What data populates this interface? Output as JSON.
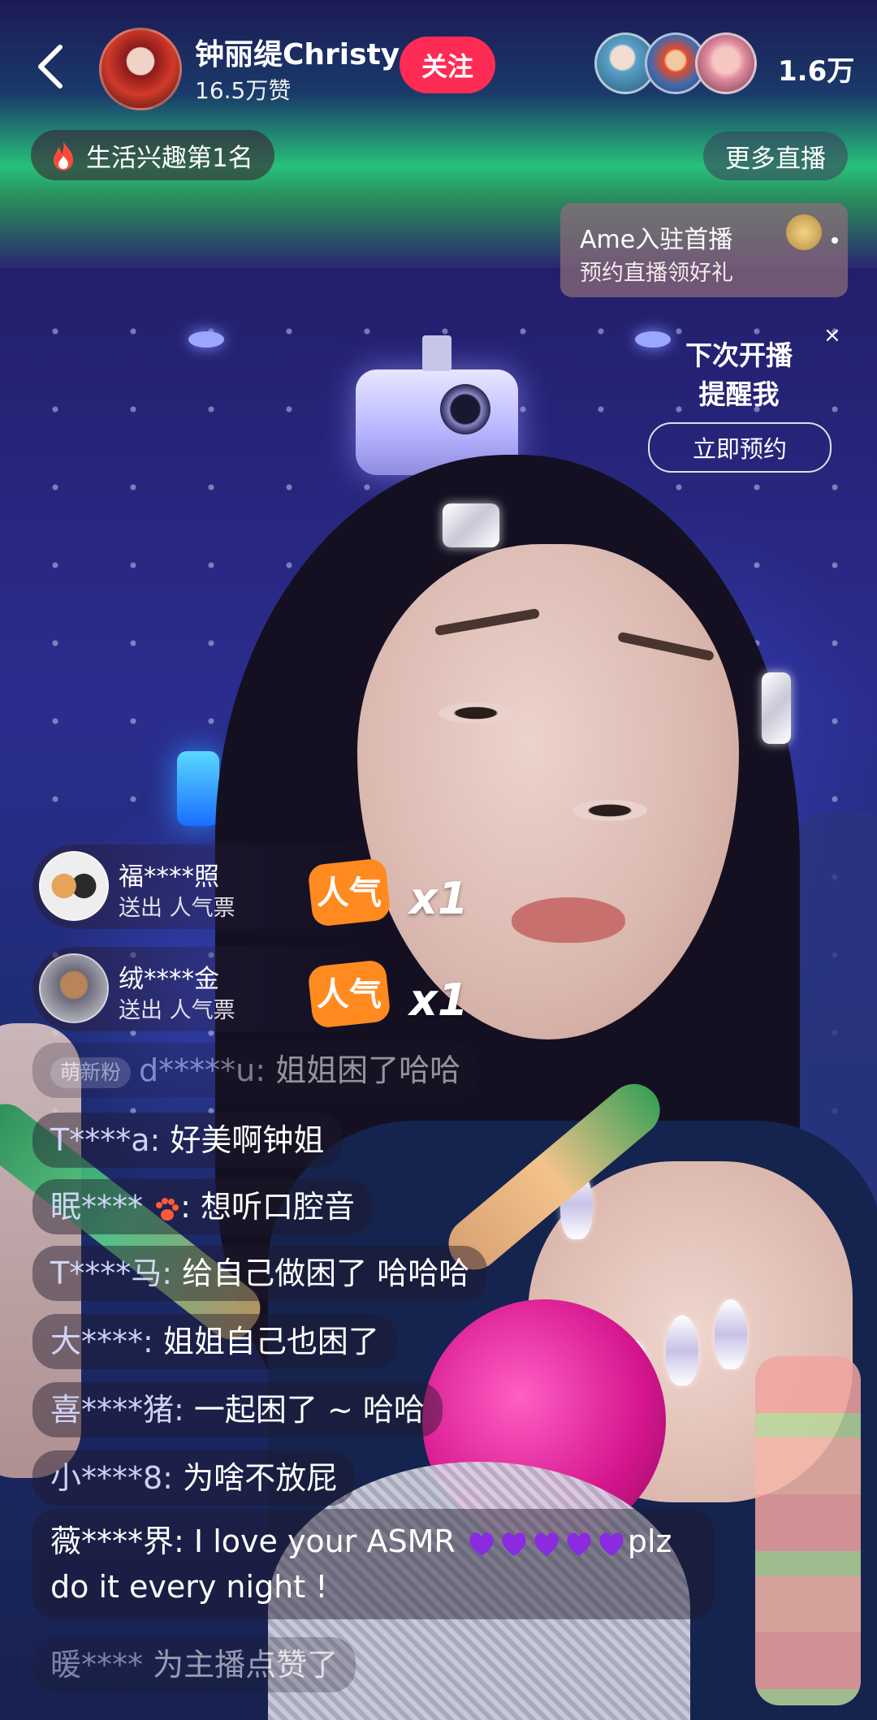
{
  "header": {
    "anchor_name": "钟丽缇Christy",
    "likes": "16.5万赞",
    "follow_label": "关注",
    "viewer_count": "1.6万",
    "rank_label": "生活兴趣第1名",
    "more_live_label": "更多直播"
  },
  "promo": {
    "title": "Ame入驻首播",
    "subtitle": "预约直播领好礼"
  },
  "reminder": {
    "line1": "下次开播",
    "line2": "提醒我",
    "button": "立即预约",
    "close": "×"
  },
  "gifts": [
    {
      "user": "福****照",
      "action": "送出 人气票",
      "count": "x1",
      "icon": "popularity-ticket-icon"
    },
    {
      "user": "绒****金",
      "action": "送出 人气票",
      "count": "x1",
      "icon": "popularity-ticket-icon"
    }
  ],
  "comments": [
    {
      "badge": "萌新粉",
      "user": "d*****u:",
      "text": "姐姐困了哈哈"
    },
    {
      "user": "T****a:",
      "text": "好美啊钟姐"
    },
    {
      "user": "眠****",
      "text": ": 想听口腔音"
    },
    {
      "user": "T****马:",
      "text": "给自己做困了 哈哈哈"
    },
    {
      "user": "大****:",
      "text": "姐姐自己也困了"
    },
    {
      "user": "喜****猪:",
      "text": "一起困了 ~ 哈哈"
    },
    {
      "user": "小****8:",
      "text": "为啥不放屁"
    },
    {
      "user": "薇****界:",
      "text_a": "I love your ASMR",
      "text_b": "plz",
      "text_c": "do it every night !"
    },
    {
      "user": "暖****",
      "text": "为主播点赞了"
    }
  ],
  "colors": {
    "follow_button": "#fe2c55",
    "heart": "#8a2be2",
    "gift_icon": "#ff8a1f"
  }
}
